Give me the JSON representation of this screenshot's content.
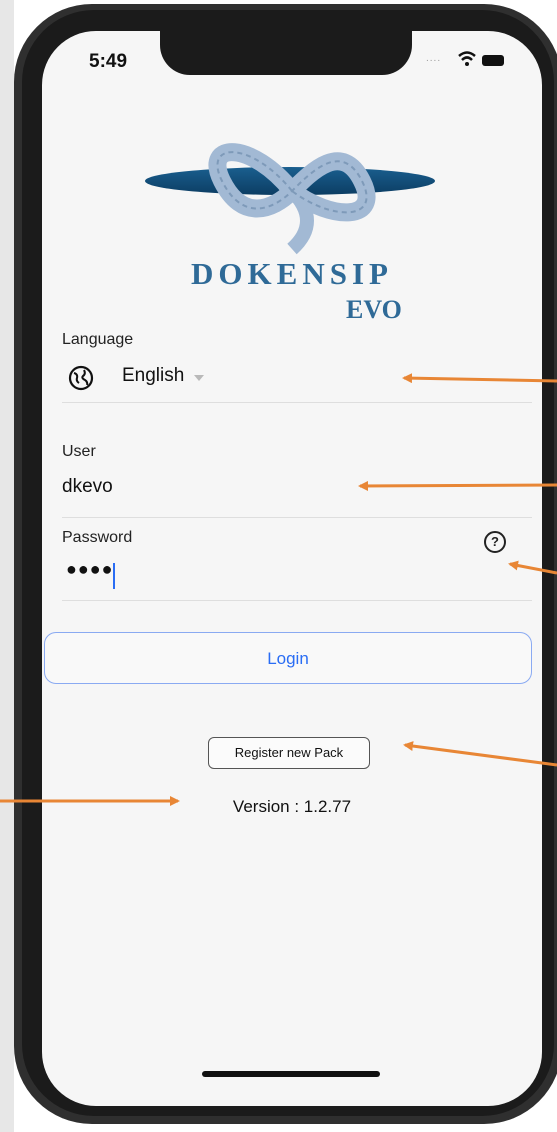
{
  "status_bar": {
    "time": "5:49",
    "signal": "....",
    "wifi_icon": "wifi-icon",
    "battery_icon": "battery-icon"
  },
  "branding": {
    "logo_icon": "rope-knot-logo",
    "name": "DOKENSIP",
    "subtitle": "EVO",
    "color": "#2f6a97"
  },
  "language": {
    "label": "Language",
    "value": "English",
    "icon": "globe-icon"
  },
  "user": {
    "label": "User",
    "value": "dkevo"
  },
  "password": {
    "label": "Password",
    "value_masked": "●●●●",
    "help_icon": "help-circle-icon"
  },
  "actions": {
    "login_label": "Login",
    "register_label": "Register new Pack"
  },
  "footer": {
    "version_text": "Version : 1.2.77"
  },
  "colors": {
    "accent": "#2a6df4",
    "arrows": "#e88635"
  }
}
